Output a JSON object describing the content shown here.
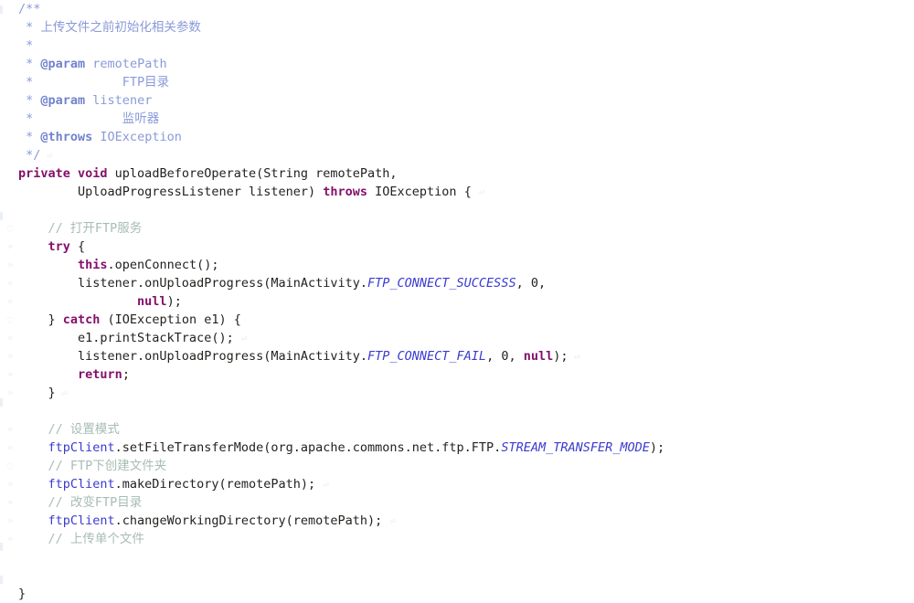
{
  "editor": {
    "language": "java",
    "background_color": "#ffffff",
    "colors": {
      "plain": "#23221f",
      "keyword": "#84106a",
      "javadoc": "#8a9ada",
      "javadoc_tag": "#7183cd",
      "line_comment": "#a8bcb4",
      "field": "#3b3bd0",
      "static_field": "#3b3bd0"
    },
    "lines": [
      {
        "indent": 20,
        "tokens": [
          {
            "kind": "jdoc",
            "text": "/**"
          }
        ]
      },
      {
        "indent": 20,
        "tokens": [
          {
            "kind": "jdoc",
            "text": " * 上传文件之前初始化相关参数"
          }
        ]
      },
      {
        "indent": 20,
        "tokens": [
          {
            "kind": "jdoc",
            "text": " *"
          }
        ]
      },
      {
        "indent": 20,
        "tokens": [
          {
            "kind": "jdoc",
            "text": " * "
          },
          {
            "kind": "jdoc-tag",
            "text": "@param"
          },
          {
            "kind": "jdoc",
            "text": " remotePath"
          }
        ]
      },
      {
        "indent": 20,
        "tokens": [
          {
            "kind": "jdoc",
            "text": " *            FTP目录"
          }
        ]
      },
      {
        "indent": 20,
        "tokens": [
          {
            "kind": "jdoc",
            "text": " * "
          },
          {
            "kind": "jdoc-tag",
            "text": "@param"
          },
          {
            "kind": "jdoc",
            "text": " listener"
          }
        ]
      },
      {
        "indent": 20,
        "tokens": [
          {
            "kind": "jdoc",
            "text": " *            监听器"
          }
        ]
      },
      {
        "indent": 20,
        "tokens": [
          {
            "kind": "jdoc",
            "text": " * "
          },
          {
            "kind": "jdoc-tag",
            "text": "@throws"
          },
          {
            "kind": "jdoc",
            "text": " IOException"
          }
        ]
      },
      {
        "indent": 20,
        "tokens": [
          {
            "kind": "jdoc",
            "text": " */"
          },
          {
            "kind": "ghost",
            "text": " ⏎"
          }
        ]
      },
      {
        "indent": 20,
        "tokens": [
          {
            "kind": "keyword",
            "text": "private void"
          },
          {
            "kind": "plain",
            "text": " uploadBeforeOperate(String remotePath,"
          }
        ]
      },
      {
        "indent": 20,
        "tokens": [
          {
            "kind": "plain",
            "text": "        UploadProgressListener listener) "
          },
          {
            "kind": "keyword",
            "text": "throws"
          },
          {
            "kind": "plain",
            "text": " IOException { "
          },
          {
            "kind": "ghost",
            "text": "⏎"
          }
        ]
      },
      {
        "indent": 20,
        "tokens": []
      },
      {
        "indent": 20,
        "tokens": [
          {
            "kind": "comment",
            "text": "    // 打开FTP服务"
          }
        ]
      },
      {
        "indent": 20,
        "tokens": [
          {
            "kind": "plain",
            "text": "    "
          },
          {
            "kind": "keyword",
            "text": "try"
          },
          {
            "kind": "plain",
            "text": " {"
          }
        ]
      },
      {
        "indent": 20,
        "tokens": [
          {
            "kind": "plain",
            "text": "        "
          },
          {
            "kind": "keyword",
            "text": "this"
          },
          {
            "kind": "plain",
            "text": ".openConnect();"
          }
        ]
      },
      {
        "indent": 20,
        "tokens": [
          {
            "kind": "plain",
            "text": "        listener.onUploadProgress(MainActivity."
          },
          {
            "kind": "static",
            "text": "FTP_CONNECT_SUCCESSS"
          },
          {
            "kind": "plain",
            "text": ", 0,"
          }
        ]
      },
      {
        "indent": 20,
        "tokens": [
          {
            "kind": "plain",
            "text": "                "
          },
          {
            "kind": "keyword",
            "text": "null"
          },
          {
            "kind": "plain",
            "text": ");"
          }
        ]
      },
      {
        "indent": 20,
        "tokens": [
          {
            "kind": "plain",
            "text": "    } "
          },
          {
            "kind": "keyword",
            "text": "catch"
          },
          {
            "kind": "plain",
            "text": " (IOException e1) {"
          }
        ]
      },
      {
        "indent": 20,
        "tokens": [
          {
            "kind": "plain",
            "text": "        e1.printStackTrace(); "
          },
          {
            "kind": "ghost",
            "text": "⏎"
          }
        ]
      },
      {
        "indent": 20,
        "tokens": [
          {
            "kind": "plain",
            "text": "        listener.onUploadProgress(MainActivity."
          },
          {
            "kind": "static",
            "text": "FTP_CONNECT_FAIL"
          },
          {
            "kind": "plain",
            "text": ", 0, "
          },
          {
            "kind": "keyword",
            "text": "null"
          },
          {
            "kind": "plain",
            "text": ");"
          },
          {
            "kind": "ghost",
            "text": " ⏎"
          }
        ]
      },
      {
        "indent": 20,
        "tokens": [
          {
            "kind": "plain",
            "text": "        "
          },
          {
            "kind": "keyword",
            "text": "return"
          },
          {
            "kind": "plain",
            "text": ";"
          }
        ]
      },
      {
        "indent": 20,
        "tokens": [
          {
            "kind": "plain",
            "text": "    }"
          },
          {
            "kind": "ghost",
            "text": " ⏎"
          }
        ]
      },
      {
        "indent": 20,
        "tokens": []
      },
      {
        "indent": 20,
        "tokens": [
          {
            "kind": "comment",
            "text": "    // 设置模式"
          }
        ]
      },
      {
        "indent": 20,
        "tokens": [
          {
            "kind": "plain",
            "text": "    "
          },
          {
            "kind": "field",
            "text": "ftpClient"
          },
          {
            "kind": "plain",
            "text": ".setFileTransferMode(org.apache.commons.net.ftp.FTP."
          },
          {
            "kind": "static",
            "text": "STREAM_TRANSFER_MODE"
          },
          {
            "kind": "plain",
            "text": ");"
          }
        ]
      },
      {
        "indent": 20,
        "tokens": [
          {
            "kind": "comment",
            "text": "    // FTP下创建文件夹"
          }
        ]
      },
      {
        "indent": 20,
        "tokens": [
          {
            "kind": "plain",
            "text": "    "
          },
          {
            "kind": "field",
            "text": "ftpClient"
          },
          {
            "kind": "plain",
            "text": ".makeDirectory(remotePath); "
          },
          {
            "kind": "ghost",
            "text": "⏎"
          }
        ]
      },
      {
        "indent": 20,
        "tokens": [
          {
            "kind": "comment",
            "text": "    // 改变FTP目录"
          }
        ]
      },
      {
        "indent": 20,
        "tokens": [
          {
            "kind": "plain",
            "text": "    "
          },
          {
            "kind": "field",
            "text": "ftpClient"
          },
          {
            "kind": "plain",
            "text": ".changeWorkingDirectory(remotePath); "
          },
          {
            "kind": "ghost",
            "text": "⏎"
          }
        ]
      },
      {
        "indent": 20,
        "tokens": [
          {
            "kind": "comment",
            "text": "    // 上传单个文件"
          }
        ]
      },
      {
        "indent": 20,
        "tokens": []
      },
      {
        "indent": 20,
        "tokens": []
      },
      {
        "indent": 20,
        "tokens": [
          {
            "kind": "plain",
            "text": "}"
          }
        ]
      }
    ],
    "gutter_marks": [
      {
        "line": 12,
        "glyph": "◌"
      },
      {
        "line": 13,
        "glyph": "»"
      },
      {
        "line": 14,
        "glyph": "»"
      },
      {
        "line": 15,
        "glyph": "»"
      },
      {
        "line": 16,
        "glyph": "»"
      },
      {
        "line": 17,
        "glyph": "◌"
      },
      {
        "line": 18,
        "glyph": "»"
      },
      {
        "line": 19,
        "glyph": "»"
      },
      {
        "line": 20,
        "glyph": "»"
      },
      {
        "line": 21,
        "glyph": "»"
      },
      {
        "line": 23,
        "glyph": "»"
      },
      {
        "line": 24,
        "glyph": "»"
      },
      {
        "line": 25,
        "glyph": "◌"
      },
      {
        "line": 26,
        "glyph": "»"
      },
      {
        "line": 27,
        "glyph": "»"
      },
      {
        "line": 28,
        "glyph": "»"
      },
      {
        "line": 29,
        "glyph": "»"
      }
    ]
  }
}
